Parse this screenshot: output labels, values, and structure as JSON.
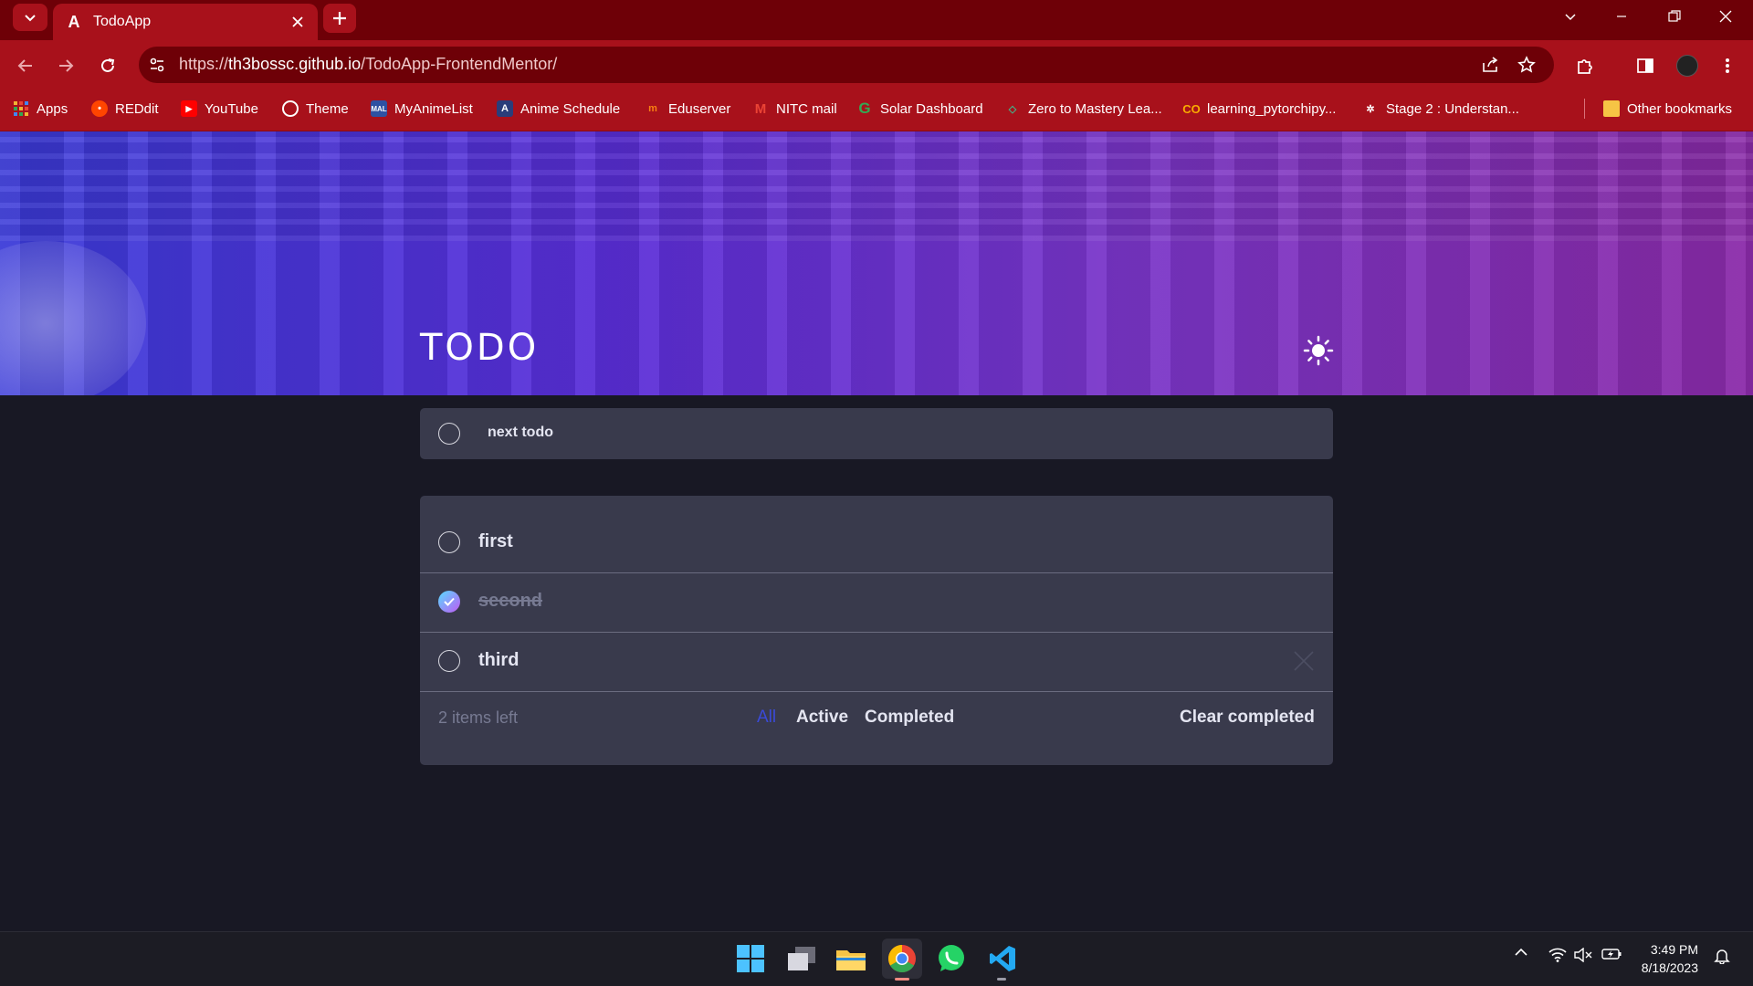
{
  "browser": {
    "tab_title": "TodoApp",
    "url_prefix": "https://",
    "url_host": "th3bossc.github.io",
    "url_path": "/TodoApp-FrontendMentor/",
    "accent": "#a8111b"
  },
  "bookmarks": [
    {
      "label": "Apps",
      "icon": "apps-grid-icon"
    },
    {
      "label": "REDdit",
      "icon": "reddit-icon"
    },
    {
      "label": "YouTube",
      "icon": "youtube-icon"
    },
    {
      "label": "Theme",
      "icon": "globe-icon"
    },
    {
      "label": "MyAnimeList",
      "icon": "mal-icon"
    },
    {
      "label": "Anime Schedule",
      "icon": "anime-schedule-icon"
    },
    {
      "label": "Eduserver",
      "icon": "eduserver-icon"
    },
    {
      "label": "NITC mail",
      "icon": "gmail-icon"
    },
    {
      "label": "Solar Dashboard",
      "icon": "google-icon"
    },
    {
      "label": "Zero to Mastery Lea...",
      "icon": "ztm-icon"
    },
    {
      "label": "learning_pytorchipy...",
      "icon": "colab-icon"
    },
    {
      "label": "Stage 2 : Understan...",
      "icon": "openai-icon"
    },
    {
      "label": "Other bookmarks",
      "icon": "folder-icon"
    }
  ],
  "app": {
    "title": "TODO",
    "new_todo_value": "next todo",
    "todos": [
      {
        "text": "first",
        "completed": false
      },
      {
        "text": "second",
        "completed": true
      },
      {
        "text": "third",
        "completed": false
      }
    ],
    "items_left": "2 items left",
    "filters": {
      "all": "All",
      "active": "Active",
      "completed": "Completed"
    },
    "active_filter": "All",
    "clear_completed": "Clear completed"
  },
  "taskbar": {
    "time": "3:49 PM",
    "date": "8/18/2023"
  }
}
